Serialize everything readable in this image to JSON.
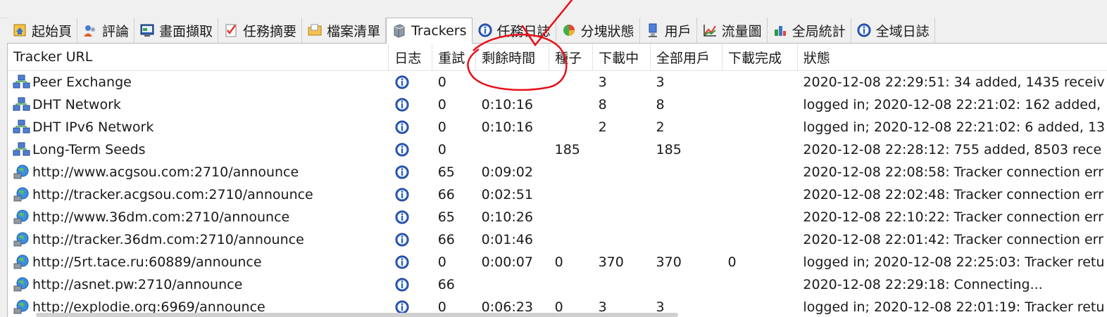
{
  "tabs": [
    {
      "label": "起始頁",
      "icon": "home-icon",
      "active": false
    },
    {
      "label": "評論",
      "icon": "comments-icon",
      "active": false
    },
    {
      "label": "畫面擷取",
      "icon": "screenshot-icon",
      "active": false
    },
    {
      "label": "任務摘要",
      "icon": "checklist-icon",
      "active": false
    },
    {
      "label": "檔案清單",
      "icon": "folder-icon",
      "active": false
    },
    {
      "label": "Trackers",
      "icon": "tracker-server-icon",
      "active": true
    },
    {
      "label": "任務日誌",
      "icon": "info-icon",
      "active": false
    },
    {
      "label": "分塊狀態",
      "icon": "pie-chart-icon",
      "active": false
    },
    {
      "label": "用戶",
      "icon": "user-icon",
      "active": false
    },
    {
      "label": "流量圖",
      "icon": "line-chart-icon",
      "active": false
    },
    {
      "label": "全局統計",
      "icon": "stats-icon",
      "active": false
    },
    {
      "label": "全域日誌",
      "icon": "info-icon",
      "active": false
    }
  ],
  "table": {
    "columns": [
      "Tracker URL",
      "日志",
      "重試",
      "剩餘時間",
      "種子",
      "下載中",
      "全部用戶",
      "下載完成",
      "狀態"
    ],
    "rows": [
      {
        "icon": "network-icon",
        "url": "Peer Exchange",
        "retry": "0",
        "remaining": "",
        "seeds": "",
        "downloading": "3",
        "peers": "3",
        "completed": "",
        "status": "2020-12-08 22:29:51: 34 added, 1435 receiv"
      },
      {
        "icon": "network-icon",
        "url": "DHT Network",
        "retry": "0",
        "remaining": "0:10:16",
        "seeds": "",
        "downloading": "8",
        "peers": "8",
        "completed": "",
        "status": "logged in; 2020-12-08 22:21:02: 162 added,"
      },
      {
        "icon": "network-icon",
        "url": "DHT IPv6 Network",
        "retry": "0",
        "remaining": "0:10:16",
        "seeds": "",
        "downloading": "2",
        "peers": "2",
        "completed": "",
        "status": "logged in; 2020-12-08 22:21:02: 6 added, 13"
      },
      {
        "icon": "network-icon",
        "url": "Long-Term Seeds",
        "retry": "0",
        "remaining": "",
        "seeds": "185",
        "downloading": "",
        "peers": "185",
        "completed": "",
        "status": "2020-12-08 22:28:12: 755 added, 8503 rece"
      },
      {
        "icon": "globe-icon",
        "url": "http://www.acgsou.com:2710/announce",
        "retry": "65",
        "remaining": "0:09:02",
        "seeds": "",
        "downloading": "",
        "peers": "",
        "completed": "",
        "status": "2020-12-08 22:08:58: Tracker connection err"
      },
      {
        "icon": "globe-icon",
        "url": "http://tracker.acgsou.com:2710/announce",
        "retry": "66",
        "remaining": "0:02:51",
        "seeds": "",
        "downloading": "",
        "peers": "",
        "completed": "",
        "status": "2020-12-08 22:02:48: Tracker connection err"
      },
      {
        "icon": "globe-icon",
        "url": "http://www.36dm.com:2710/announce",
        "retry": "65",
        "remaining": "0:10:26",
        "seeds": "",
        "downloading": "",
        "peers": "",
        "completed": "",
        "status": "2020-12-08 22:10:22: Tracker connection err"
      },
      {
        "icon": "globe-icon",
        "url": "http://tracker.36dm.com:2710/announce",
        "retry": "66",
        "remaining": "0:01:46",
        "seeds": "",
        "downloading": "",
        "peers": "",
        "completed": "",
        "status": "2020-12-08 22:01:42: Tracker connection err"
      },
      {
        "icon": "globe-icon",
        "url": "http://5rt.tace.ru:60889/announce",
        "retry": "0",
        "remaining": "0:00:07",
        "seeds": "0",
        "downloading": "370",
        "peers": "370",
        "completed": "0",
        "status": "logged in; 2020-12-08 22:25:03: Tracker retu"
      },
      {
        "icon": "globe-icon",
        "url": "http://asnet.pw:2710/announce",
        "retry": "66",
        "remaining": "",
        "seeds": "",
        "downloading": "",
        "peers": "",
        "completed": "",
        "status": "2020-12-08 22:29:18: Connecting..."
      },
      {
        "icon": "globe-icon",
        "url": "http://explodie.org:6969/announce",
        "retry": "0",
        "remaining": "0:06:23",
        "seeds": "0",
        "downloading": "3",
        "peers": "3",
        "completed": "",
        "status": "logged in; 2020-12-08 22:01:19: Tracker retu"
      }
    ]
  },
  "colors": {
    "annotation": "#e8101a",
    "selected_tab": "#ffffff",
    "header_border": "#e3e3e3"
  }
}
